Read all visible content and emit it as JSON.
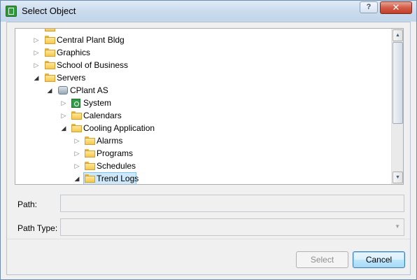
{
  "window": {
    "title": "Select Object",
    "help_label": "?",
    "close_label": "✕"
  },
  "tree": {
    "nodes": [
      {
        "label": "Central Plant Bldg",
        "expanded": false,
        "icon": "folder-icon"
      },
      {
        "label": "Graphics",
        "expanded": false,
        "icon": "folder-icon"
      },
      {
        "label": "School of Business",
        "expanded": false,
        "icon": "folder-icon"
      },
      {
        "label": "Servers",
        "expanded": true,
        "icon": "folder-icon"
      },
      {
        "label": "CPlant AS",
        "expanded": true,
        "icon": "server-icon"
      },
      {
        "label": "System",
        "expanded": false,
        "icon": "system-icon"
      },
      {
        "label": "Calendars",
        "expanded": false,
        "icon": "folder-icon"
      },
      {
        "label": "Cooling Application",
        "expanded": true,
        "icon": "folder-icon"
      },
      {
        "label": "Alarms",
        "expanded": false,
        "icon": "folder-icon"
      },
      {
        "label": "Programs",
        "expanded": false,
        "icon": "folder-icon"
      },
      {
        "label": "Schedules",
        "expanded": false,
        "icon": "folder-icon"
      },
      {
        "label": "Trend Logs",
        "expanded": true,
        "icon": "folder-icon",
        "selected": true
      }
    ],
    "expander_collapsed": "▷",
    "expander_expanded": "◢"
  },
  "scrollbar": {
    "up_arrow": "▲",
    "down_arrow": "▼"
  },
  "fields": {
    "path_label": "Path:",
    "path_value": "",
    "path_type_label": "Path Type:",
    "path_type_value": "",
    "combo_arrow": "▼"
  },
  "buttons": {
    "select_label": "Select",
    "cancel_label": "Cancel"
  },
  "colors": {
    "selection_bg": "#cde8fb",
    "folder_yellow": "#f5c84b",
    "close_red": "#c13f2b"
  }
}
